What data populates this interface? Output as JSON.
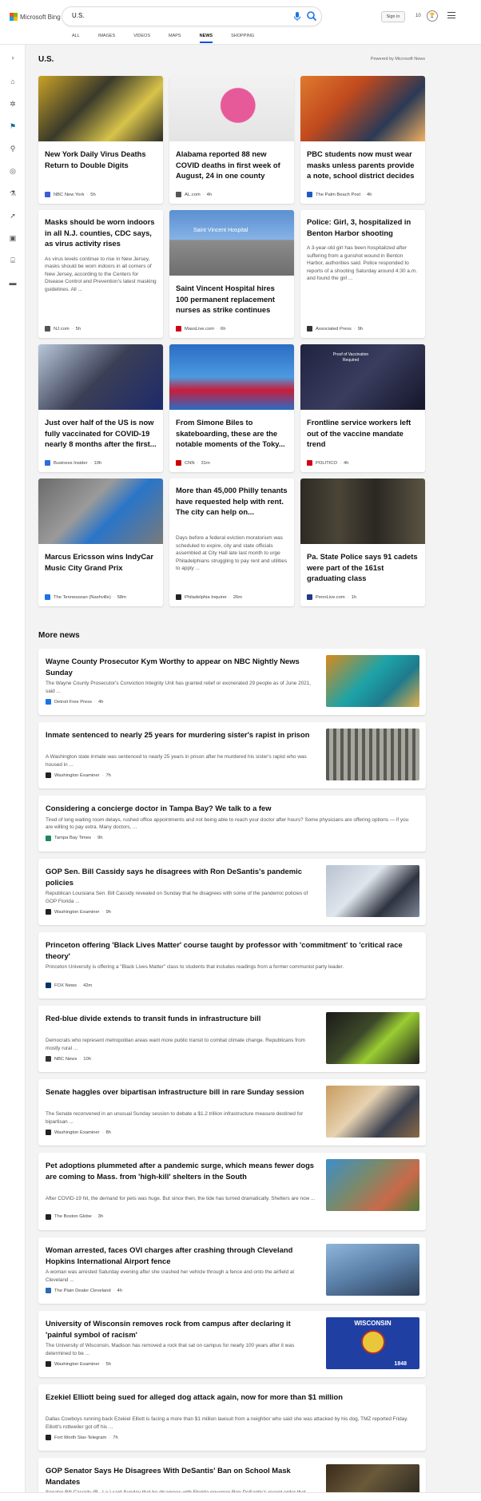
{
  "header": {
    "brand": "Microsoft Bing",
    "query": "U.S.",
    "tabs": [
      "ALL",
      "IMAGES",
      "VIDEOS",
      "MAPS",
      "NEWS",
      "SHOPPING"
    ],
    "active_tab": "NEWS",
    "signin_label": "Sign in",
    "reward_count": "10"
  },
  "section": {
    "title": "U.S.",
    "powered": "Powered by Microsoft News"
  },
  "cards": [
    {
      "title": "New York Daily Virus Deaths Return to Double Digits",
      "snippet": "",
      "source": "NBC New York",
      "time": "5h",
      "fav_color": "#3b5bdb",
      "img": "protest-photo"
    },
    {
      "title": "Alabama reported 88 new COVID deaths in first week of August, 24 in one county",
      "snippet": "",
      "source": "AL.com",
      "time": "4h",
      "fav_color": "#555555",
      "img": "alabama-map"
    },
    {
      "title": "PBC students now must wear masks unless parents provide a note, school district decides",
      "snippet": "",
      "source": "The Palm Beach Post",
      "time": "4h",
      "fav_color": "#1e5bc6",
      "img": "classroom-photo"
    },
    {
      "title": "Masks should be worn indoors in all N.J. counties, CDC says, as virus activity rises",
      "snippet": "As virus levels continue to rise in New Jersey, masks should be worn indoors in all corners of New Jersey, according to the Centers for Disease Control and Prevention's latest masking guidelines. All ...",
      "source": "NJ.com",
      "time": "5h",
      "fav_color": "#555555",
      "img": ""
    },
    {
      "title": "Saint Vincent Hospital hires 100 permanent replacement nurses as strike continues",
      "snippet": "",
      "source": "MassLive.com",
      "time": "6h",
      "fav_color": "#d0021b",
      "img": "hospital-photo"
    },
    {
      "title": "Police: Girl, 3, hospitalized in Benton Harbor shooting",
      "snippet": "A 3-year-old girl has been hospitalized after suffering from a gunshot wound in Benton Harbor, authorities said. Police responded to reports of a shooting Saturday around 4:30 a.m. and found the girl ...",
      "source": "Associated Press",
      "time": "9h",
      "fav_color": "#333333",
      "img": ""
    },
    {
      "title": "Just over half of the US is now fully vaccinated for COVID-19 nearly 8 months after the first...",
      "snippet": "",
      "source": "Business Insider",
      "time": "10h",
      "fav_color": "#2d6be4",
      "img": "vaccine-photo"
    },
    {
      "title": "From Simone Biles to skateboarding, these are the notable moments of the Toky...",
      "snippet": "",
      "source": "CNN",
      "time": "31m",
      "fav_color": "#cc0000",
      "img": "gymnast-photo"
    },
    {
      "title": "Frontline service workers left out of the vaccine mandate trend",
      "snippet": "",
      "source": "POLITICO",
      "time": "4h",
      "fav_color": "#d0021b",
      "img": "vaccination-sign-photo"
    },
    {
      "title": "Marcus Ericsson wins IndyCar Music City Grand Prix",
      "snippet": "",
      "source": "The Tennessean (Nashville)",
      "time": "58m",
      "fav_color": "#1a73e8",
      "img": "racing-photo"
    },
    {
      "title": "More than 45,000 Philly tenants have requested help with rent. The city can help on...",
      "snippet": "Days before a federal eviction moratorium was scheduled to expire, city and state officials assembled at City Hall late last month to urge Philadelphians struggling to pay rent and utilities to apply ...",
      "source": "Philadelphia Inquirer",
      "time": "26m",
      "fav_color": "#222222",
      "img": ""
    },
    {
      "title": "Pa. State Police says 91 cadets were part of the 161st graduating class",
      "snippet": "",
      "source": "PennLive.com",
      "time": "1h",
      "fav_color": "#1e3a8a",
      "img": "cadets-photo"
    }
  ],
  "more_news": {
    "title": "More news",
    "items": [
      {
        "title": "Wayne County Prosecutor Kym Worthy to appear on NBC Nightly News Sunday",
        "snippet": "The Wayne County Prosecutor's Conviction Integrity Unit has granted relief or exonerated 29 people as of June 2021, said ...",
        "source": "Detroit Free Press",
        "time": "4h",
        "fav_color": "#1a73e8",
        "thumb": "portrait-photo"
      },
      {
        "title": "Inmate sentenced to nearly 25 years for murdering sister's rapist in prison",
        "snippet": "A Washington state inmate was sentenced to nearly 25 years in prison after he murdered his sister's rapist who was housed in ...",
        "source": "Washington Examiner",
        "time": "7h",
        "fav_color": "#222222",
        "thumb": "prison-photo"
      },
      {
        "title": "Considering a concierge doctor in Tampa Bay? We talk to a few",
        "snippet": "Tired of long waiting room delays, rushed office appointments and not being able to reach your doctor after hours? Some physicians are offering options — if you are willing to pay extra. Many doctors, ...",
        "source": "Tampa Bay Times",
        "time": "9h",
        "fav_color": "#1b8a5a",
        "thumb": ""
      },
      {
        "title": "GOP Sen. Bill Cassidy says he disagrees with Ron DeSantis's pandemic policies",
        "snippet": "Republican Louisiana Sen. Bill Cassidy revealed on Sunday that he disagrees with some of the pandemic policies of GOP Florida ...",
        "source": "Washington Examiner",
        "time": "9h",
        "fav_color": "#222222",
        "thumb": "senator-photo"
      },
      {
        "title": "Princeton offering 'Black Lives Matter' course taught by professor with 'commitment' to 'critical race theory'",
        "snippet": "Princeton University is offering a \"Black Lives Matter\" class to students that includes readings from a former communist party leader.",
        "source": "FOX News",
        "time": "42m",
        "fav_color": "#003366",
        "thumb": ""
      },
      {
        "title": "Red-blue divide extends to transit funds in infrastructure bill",
        "snippet": "Democrats who represent metropolitan areas want more public transit to combat climate change. Republicans from mostly rural ...",
        "source": "NBC News",
        "time": "10h",
        "fav_color": "#333333",
        "thumb": "transit-workers-photo"
      },
      {
        "title": "Senate haggles over bipartisan infrastructure bill in rare Sunday session",
        "snippet": "The Senate reconvened in an unusual Sunday session to debate a $1.2 trillion infrastructure measure destined for bipartisan ...",
        "source": "Washington Examiner",
        "time": "8h",
        "fav_color": "#222222",
        "thumb": "capitol-photo"
      },
      {
        "title": "Pet adoptions plummeted after a pandemic surge, which means fewer dogs are coming to Mass. from 'high-kill' shelters in the South",
        "snippet": "After COVID-19 hit, the demand for pets was huge. But since then, the tide has turned dramatically. Shelters are now ...",
        "source": "The Boston Globe",
        "time": "3h",
        "fav_color": "#222222",
        "thumb": "dog-photo"
      },
      {
        "title": "Woman arrested, faces OVI charges after crashing through Cleveland Hopkins International Airport fence",
        "snippet": "A woman was arrested Saturday evening after she crashed her vehicle through a fence and onto the airfield at Cleveland ...",
        "source": "The Plain Dealer Cleveland",
        "time": "4h",
        "fav_color": "#2b6cb0",
        "thumb": "airplane-photo"
      },
      {
        "title": "University of Wisconsin removes rock from campus after declaring it 'painful symbol of racism'",
        "snippet": "The University of Wisconsin, Madison has removed a rock that sat on campus for nearly 100 years after it was determined to be ...",
        "source": "Washington Examiner",
        "time": "5h",
        "fav_color": "#222222",
        "thumb": "wisconsin-flag"
      },
      {
        "title": "Ezekiel Elliott being sued for alleged dog attack again, now for more than $1 million",
        "snippet": "Dallas Cowboys running back Ezekiel Elliott is facing a more than $1 million lawsuit from a neighbor who said she was attacked by his dog, TMZ reported Friday. Elliott's rottweiler got off his ...",
        "source": "Fort Worth Star-Telegram",
        "time": "7h",
        "fav_color": "#222222",
        "thumb": ""
      },
      {
        "title": "GOP Senator Says He Disagrees With DeSantis' Ban on School Mask Mandates",
        "snippet": "Senator Bill Cassidy (R., La.) said Sunday that he disagrees with Florida governor Ron DeSantis's recent order that bans mask ...",
        "source": "National Review",
        "time": "10h",
        "fav_color": "#222222",
        "thumb": "speaker-photo"
      }
    ]
  },
  "wisconsin_text": "WISCONSIN",
  "wisconsin_year": "1848",
  "vaccine_sign_text": "Proof of Vaccination Required",
  "hospital_sign_text": "Saint Vincent Hospital"
}
